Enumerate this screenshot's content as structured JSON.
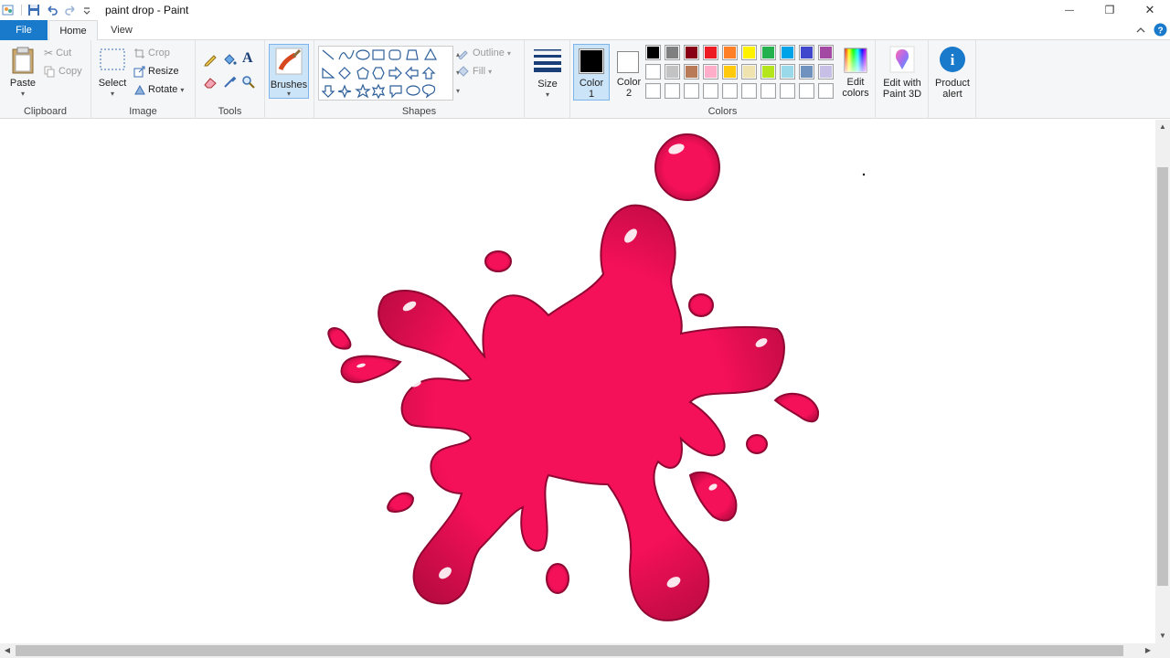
{
  "window": {
    "title": "paint drop - Paint",
    "minimize": "—",
    "restore": "❐",
    "close": "✕"
  },
  "tabs": {
    "file": "File",
    "home": "Home",
    "view": "View"
  },
  "clipboard": {
    "paste": "Paste",
    "cut": "Cut",
    "copy": "Copy",
    "label": "Clipboard"
  },
  "image": {
    "select": "Select",
    "crop": "Crop",
    "resize": "Resize",
    "rotate": "Rotate",
    "label": "Image"
  },
  "tools": {
    "label": "Tools",
    "text_tool": "A"
  },
  "brushes": {
    "label": "Brushes"
  },
  "shapes": {
    "outline": "Outline",
    "fill": "Fill",
    "label": "Shapes"
  },
  "size": {
    "label": "Size"
  },
  "colors": {
    "color1": "Color 1",
    "color2": "Color 2",
    "edit_colors": "Edit colors",
    "label": "Colors",
    "color1_value": "#000000",
    "color2_value": "#ffffff",
    "palette_row1": [
      "#000000",
      "#7f7f7f",
      "#880015",
      "#ed1c24",
      "#ff7f27",
      "#fff200",
      "#22b14c",
      "#00a2e8",
      "#3f48cc",
      "#a349a4"
    ],
    "palette_row2": [
      "#ffffff",
      "#c3c3c3",
      "#b97a57",
      "#ffaec9",
      "#ffc90e",
      "#efe4b0",
      "#b5e61d",
      "#99d9ea",
      "#7092be",
      "#c8bfe7"
    ],
    "palette_row3": [
      "#ffffff",
      "#ffffff",
      "#ffffff",
      "#ffffff",
      "#ffffff",
      "#ffffff",
      "#ffffff",
      "#ffffff",
      "#ffffff",
      "#ffffff"
    ]
  },
  "paint3d": {
    "label": "Edit with Paint 3D"
  },
  "product_alert": {
    "label": "Product alert"
  },
  "splash": {
    "main_color": "#f5105a",
    "shadow_color": "#b50a3f",
    "highlight_color": "#ffffff"
  }
}
